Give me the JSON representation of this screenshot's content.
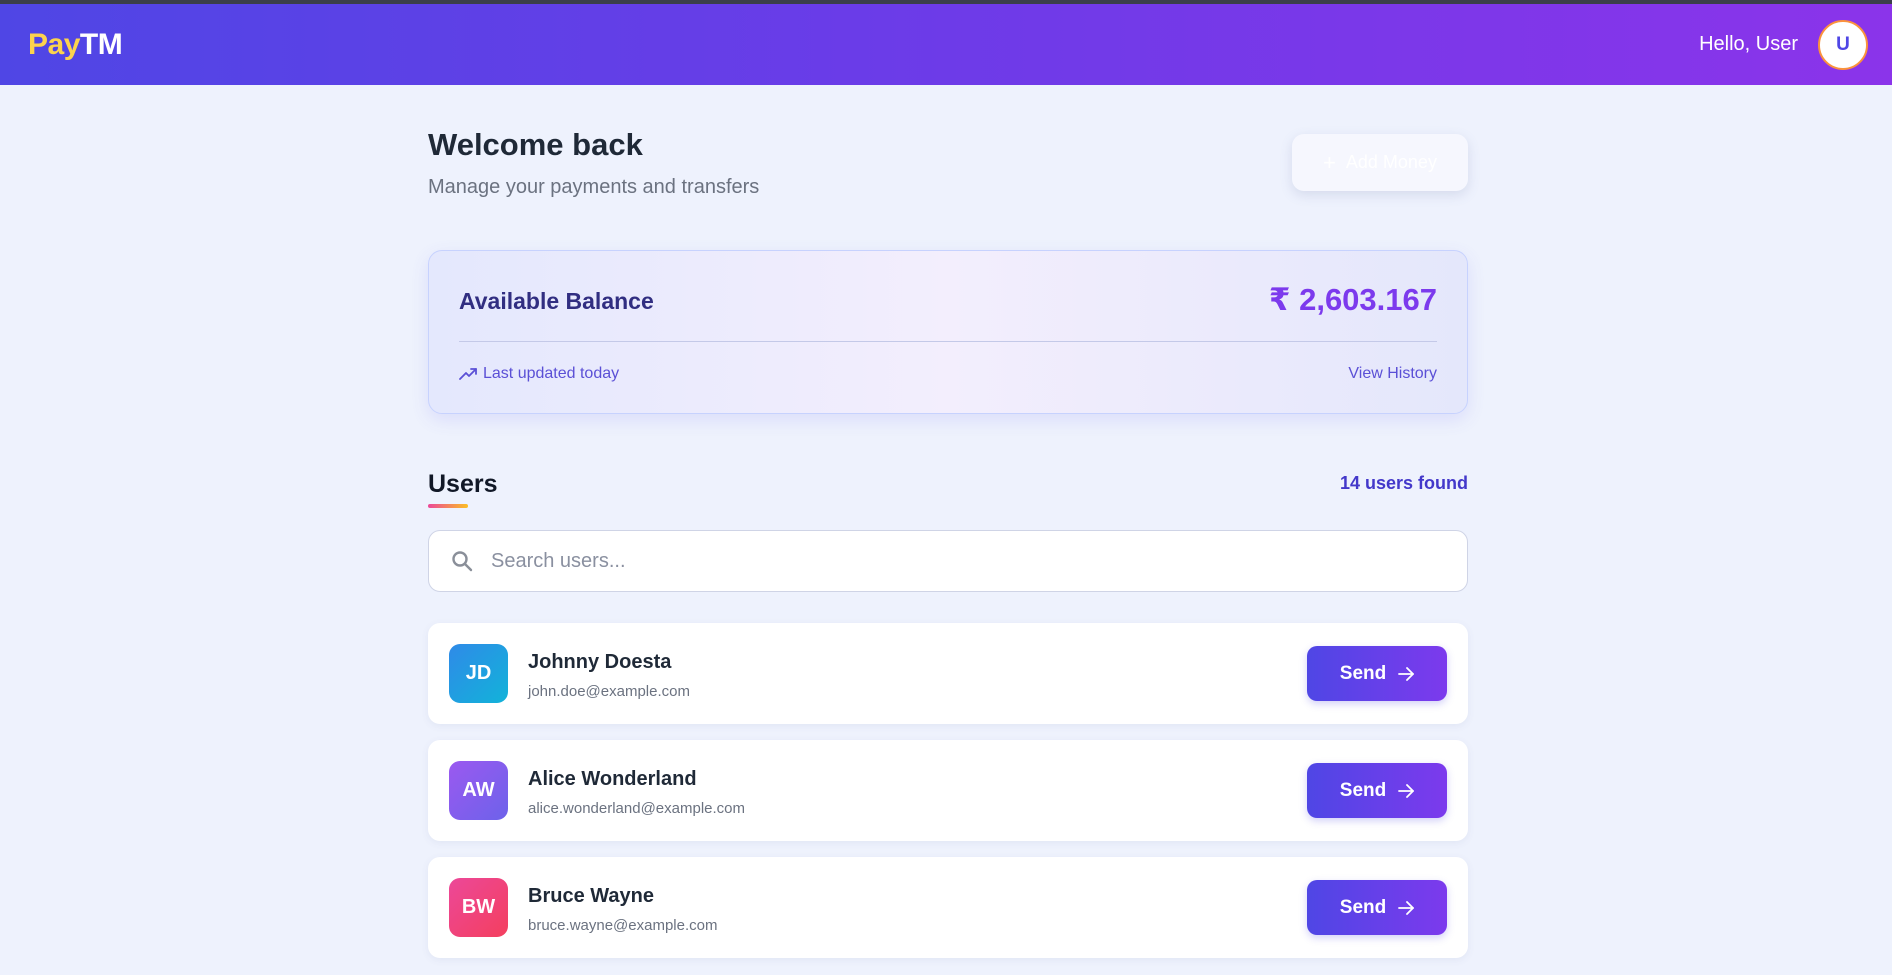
{
  "header": {
    "logo_pay": "Pay",
    "logo_tm": "TM",
    "greeting": "Hello, User",
    "avatar_initial": "U"
  },
  "welcome": {
    "title": "Welcome back",
    "subtitle": "Manage your payments and transfers",
    "add_money_label": "Add Money",
    "add_money_icon": "plus-icon"
  },
  "balance": {
    "label": "Available Balance",
    "amount": "₹ 2,603.167",
    "last_updated": "Last updated today",
    "last_updated_icon": "trending-up-icon",
    "view_history": "View History"
  },
  "users": {
    "title": "Users",
    "count_label": "14 users found",
    "search_placeholder": "Search users...",
    "search_icon": "search-icon",
    "send_label": "Send",
    "send_icon": "arrow-right-icon",
    "list": [
      {
        "initials": "JD",
        "name": "Johnny Doesta",
        "email": "john.doe@example.com",
        "gradient": [
          "#2f8ae8",
          "#12b3d9"
        ]
      },
      {
        "initials": "AW",
        "name": "Alice Wonderland",
        "email": "alice.wonderland@example.com",
        "gradient": [
          "#9b59f0",
          "#6d62ea"
        ]
      },
      {
        "initials": "BW",
        "name": "Bruce Wayne",
        "email": "bruce.wayne@example.com",
        "gradient": [
          "#ec4899",
          "#f43f5e"
        ]
      }
    ]
  },
  "colors": {
    "header_start": "#4f46e5",
    "header_end": "#8b34ea",
    "logo_accent": "#fcd34d",
    "balance_amount": "#7c3aed",
    "accent": "#4f46e5"
  }
}
